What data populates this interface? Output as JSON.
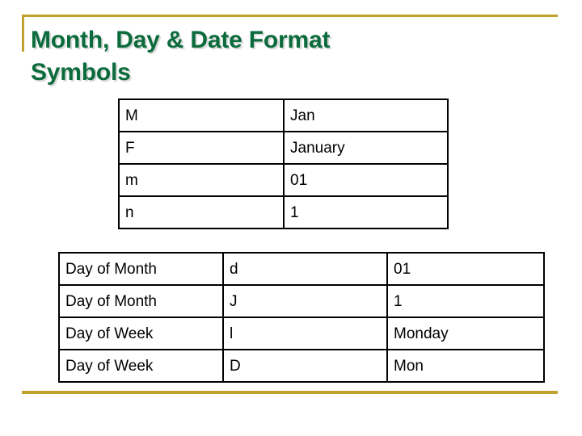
{
  "slide": {
    "title": "Month, Day & Date Format\nSymbols",
    "title_color": "#0b6b3c",
    "accent_color": "#bfa22e",
    "background_color": "#ffffff"
  },
  "table_symbols": {
    "name": "month-format-symbols-table",
    "rows": [
      {
        "symbol": "M",
        "example": "Jan"
      },
      {
        "symbol": "F",
        "example": "January"
      },
      {
        "symbol": "m",
        "example": "01"
      },
      {
        "symbol": "n",
        "example": "1"
      }
    ]
  },
  "table_days": {
    "name": "day-format-symbols-table",
    "rows": [
      {
        "description": "Day of Month",
        "symbol": "d",
        "example": "01"
      },
      {
        "description": "Day of Month",
        "symbol": "J",
        "example": "1"
      },
      {
        "description": "Day of Week",
        "symbol": "l",
        "example": "Monday"
      },
      {
        "description": "Day of Week",
        "symbol": "D",
        "example": "Mon"
      }
    ]
  }
}
